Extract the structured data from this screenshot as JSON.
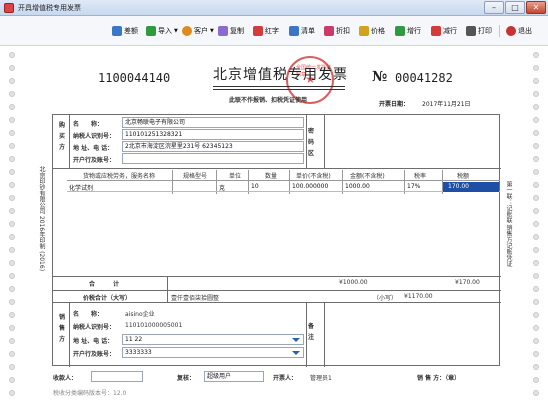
{
  "window": {
    "title": "开具增值税专用发票",
    "min_label": "–",
    "max_label": "□",
    "close_label": "✕"
  },
  "toolbar": {
    "items": [
      {
        "label": "差额",
        "icon": "difference-icon",
        "color": "#3a78c7"
      },
      {
        "label": "导入",
        "icon": "import-icon",
        "color": "#2f9a3f",
        "arrow": "▼"
      },
      {
        "label": "客户",
        "icon": "customer-icon",
        "color": "#e08a1e",
        "arrow": "▼"
      },
      {
        "label": "复制",
        "icon": "copy-icon",
        "color": "#8a6bd1"
      },
      {
        "label": "红字",
        "icon": "red-ink-icon",
        "color": "#d53b3b"
      },
      {
        "label": "清单",
        "icon": "list-icon",
        "color": "#3a78c7"
      },
      {
        "label": "折扣",
        "icon": "discount-icon",
        "color": "#cc3a6a"
      },
      {
        "label": "价格",
        "icon": "price-icon",
        "color": "#d0a21e"
      },
      {
        "label": "增行",
        "icon": "add-row-icon",
        "color": "#2f9a3f"
      },
      {
        "label": "减行",
        "icon": "remove-row-icon",
        "color": "#d53b3b"
      },
      {
        "label": "打印",
        "icon": "print-icon",
        "color": "#555555"
      },
      {
        "label": "退出",
        "icon": "exit-icon",
        "color": "#c83232"
      }
    ]
  },
  "invoice": {
    "code": "1100044140",
    "title": "北京增值税专用发票",
    "subtitle": "此联不作报销、扣税凭证使用",
    "number_symbol": "№",
    "number": "00041282",
    "date_label": "开票日期：",
    "date": "2017年11月21日",
    "seal_text": "全国统一发票监制章",
    "seal_star": "★"
  },
  "buyer": {
    "side_label": "购买方",
    "name_label": "名　　称：",
    "name": "北京畅联电子有限公司",
    "tax_id_label": "纳税人识别号：",
    "tax_id": "110101251328321",
    "address_label": "地 址、电 话：",
    "address": "2北京市海淀区浣星里231号 62345123",
    "bank_label": "开户行及账号：",
    "bank": ""
  },
  "password_area": {
    "label": "密码区"
  },
  "items_table": {
    "headers": [
      "货物或应税劳务，服务名称",
      "规格型号",
      "单位",
      "数量",
      "单价(不含税)",
      "金额(不含税)",
      "税率",
      "税额"
    ],
    "rows": [
      {
        "name": "化学试剂",
        "spec": "",
        "unit": "克",
        "qty": "10",
        "price": "100.000000",
        "amount": "1000.00",
        "rate": "17%",
        "tax": "170.00"
      }
    ]
  },
  "totals": {
    "total_label": "合　　　计",
    "amount_total": "¥1000.00",
    "tax_total": "¥170.00",
    "sum_label": "价税合计（大写）",
    "sum_upper": "壹仟壹佰柒拾圆整",
    "small_label": "（小写）",
    "sum_lower": "¥1170.00"
  },
  "seller": {
    "side_label": "销售方",
    "name_label": "名　　称：",
    "name": "aisino企业",
    "tax_id_label": "纳税人识别号：",
    "tax_id": "110101000005001",
    "address_label": "地 址、电 话：",
    "address": "11 22",
    "bank_label": "开户行及账号：",
    "bank": "3333333"
  },
  "remarks": {
    "label": "备注"
  },
  "bottom": {
    "payee_label": "收款人：",
    "payee": "",
    "reviewer_label": "复核：",
    "reviewer": "超级用户",
    "drawer_label": "开票人：",
    "drawer": "管理员1",
    "seller_label": "销 售 方：（章）",
    "footnote": "税收分类编码版本号：12.0"
  },
  "side_text": {
    "left": "北京印钞有限公司  2016年印制  (2016)",
    "right": "第一联：记账联  销售方记账凭证"
  }
}
